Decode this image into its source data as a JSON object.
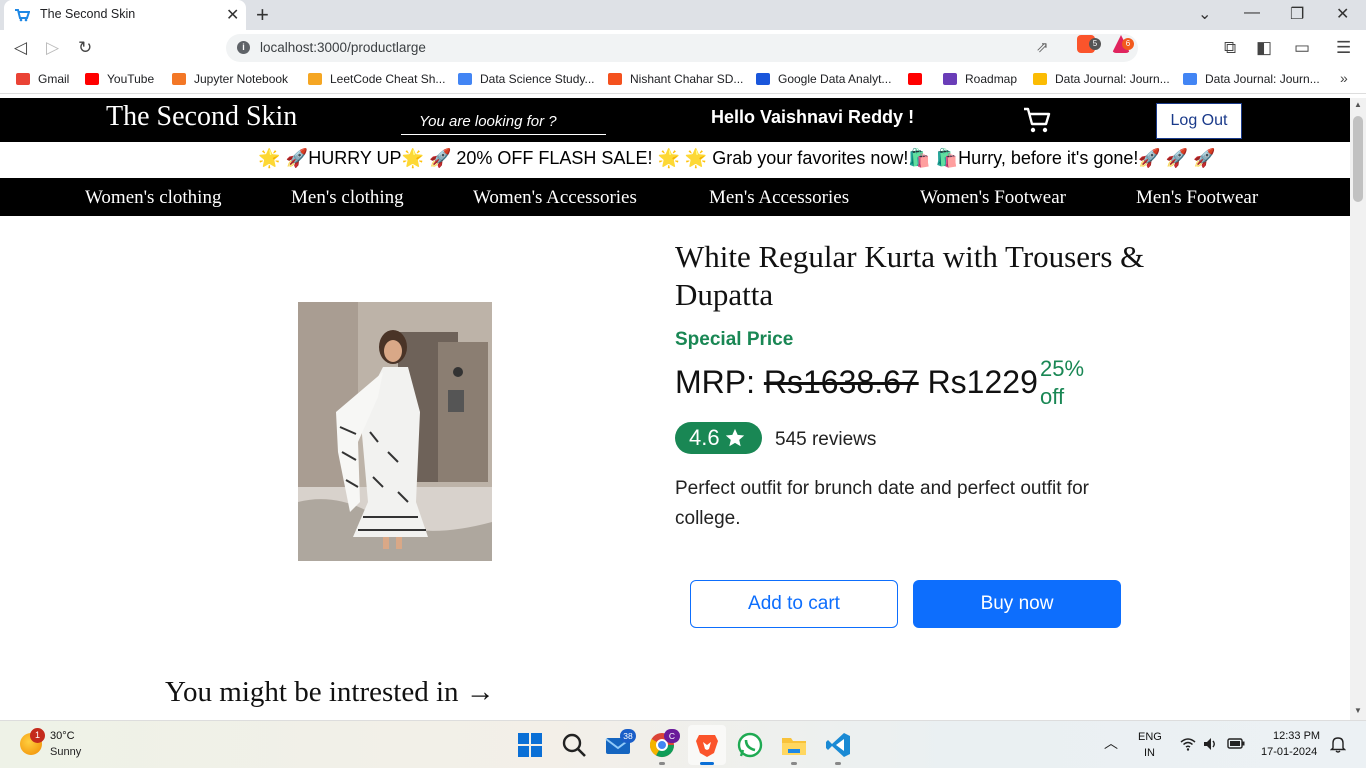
{
  "browser": {
    "tab_title": "The Second Skin",
    "url": "localhost:3000/productlarge",
    "ext_badge_1": "5",
    "ext_badge_2": "6"
  },
  "bookmarks": [
    {
      "label": "Gmail",
      "color": "#ea4335"
    },
    {
      "label": "YouTube",
      "color": "#ff0000"
    },
    {
      "label": "Jupyter Notebook",
      "color": "#f37726"
    },
    {
      "label": "LeetCode Cheat Sh...",
      "color": "#f5a623"
    },
    {
      "label": "Data Science Study...",
      "color": "#4285f4"
    },
    {
      "label": "Nishant Chahar SD...",
      "color": "#f4511e"
    },
    {
      "label": "Google Data Analyt...",
      "color": "#1a56db"
    },
    {
      "label": "",
      "color": "#ff0000"
    },
    {
      "label": "Roadmap",
      "color": "#6a3db8"
    },
    {
      "label": "Data Journal: Journ...",
      "color": "#fbbc04"
    },
    {
      "label": "Data Journal: Journ...",
      "color": "#4285f4"
    }
  ],
  "site": {
    "brand": "The Second Skin",
    "search_placeholder": "You are looking for ?",
    "greeting": "Hello Vaishnavi Reddy !",
    "logout_label": "Log Out",
    "promo": "🌟 🚀HURRY UP🌟 🚀 20% OFF FLASH SALE! 🌟 🌟 Grab your favorites now!🛍️ 🛍️Hurry, before it's gone!🚀 🚀 🚀",
    "categories": [
      "Women's clothing",
      "Men's clothing",
      "Women's Accessories",
      "Men's Accessories",
      "Women's Footwear",
      "Men's Footwear"
    ]
  },
  "product": {
    "title": "White Regular Kurta with Trousers & Dupatta",
    "special_price_label": "Special Price",
    "mrp_label": "MRP:",
    "mrp_old": "Rs1638.67",
    "price": "Rs1229",
    "discount": "25% off",
    "rating": "4.6",
    "reviews": "545 reviews",
    "description": "Perfect outfit for brunch date and perfect outfit for college.",
    "add_to_cart_label": "Add to cart",
    "buy_now_label": "Buy now"
  },
  "recommendations": {
    "heading": "You might be intrested in →"
  },
  "taskbar": {
    "weather_temp": "30°C",
    "weather_cond": "Sunny",
    "weather_badge": "1",
    "mail_badge": "38",
    "chrome_badge": "C",
    "lang_line1": "ENG",
    "lang_line2": "IN",
    "time": "12:33 PM",
    "date": "17-01-2024"
  },
  "colors": {
    "accent_green": "#198754",
    "primary_blue": "#0d6efd",
    "header_black": "#000000"
  }
}
